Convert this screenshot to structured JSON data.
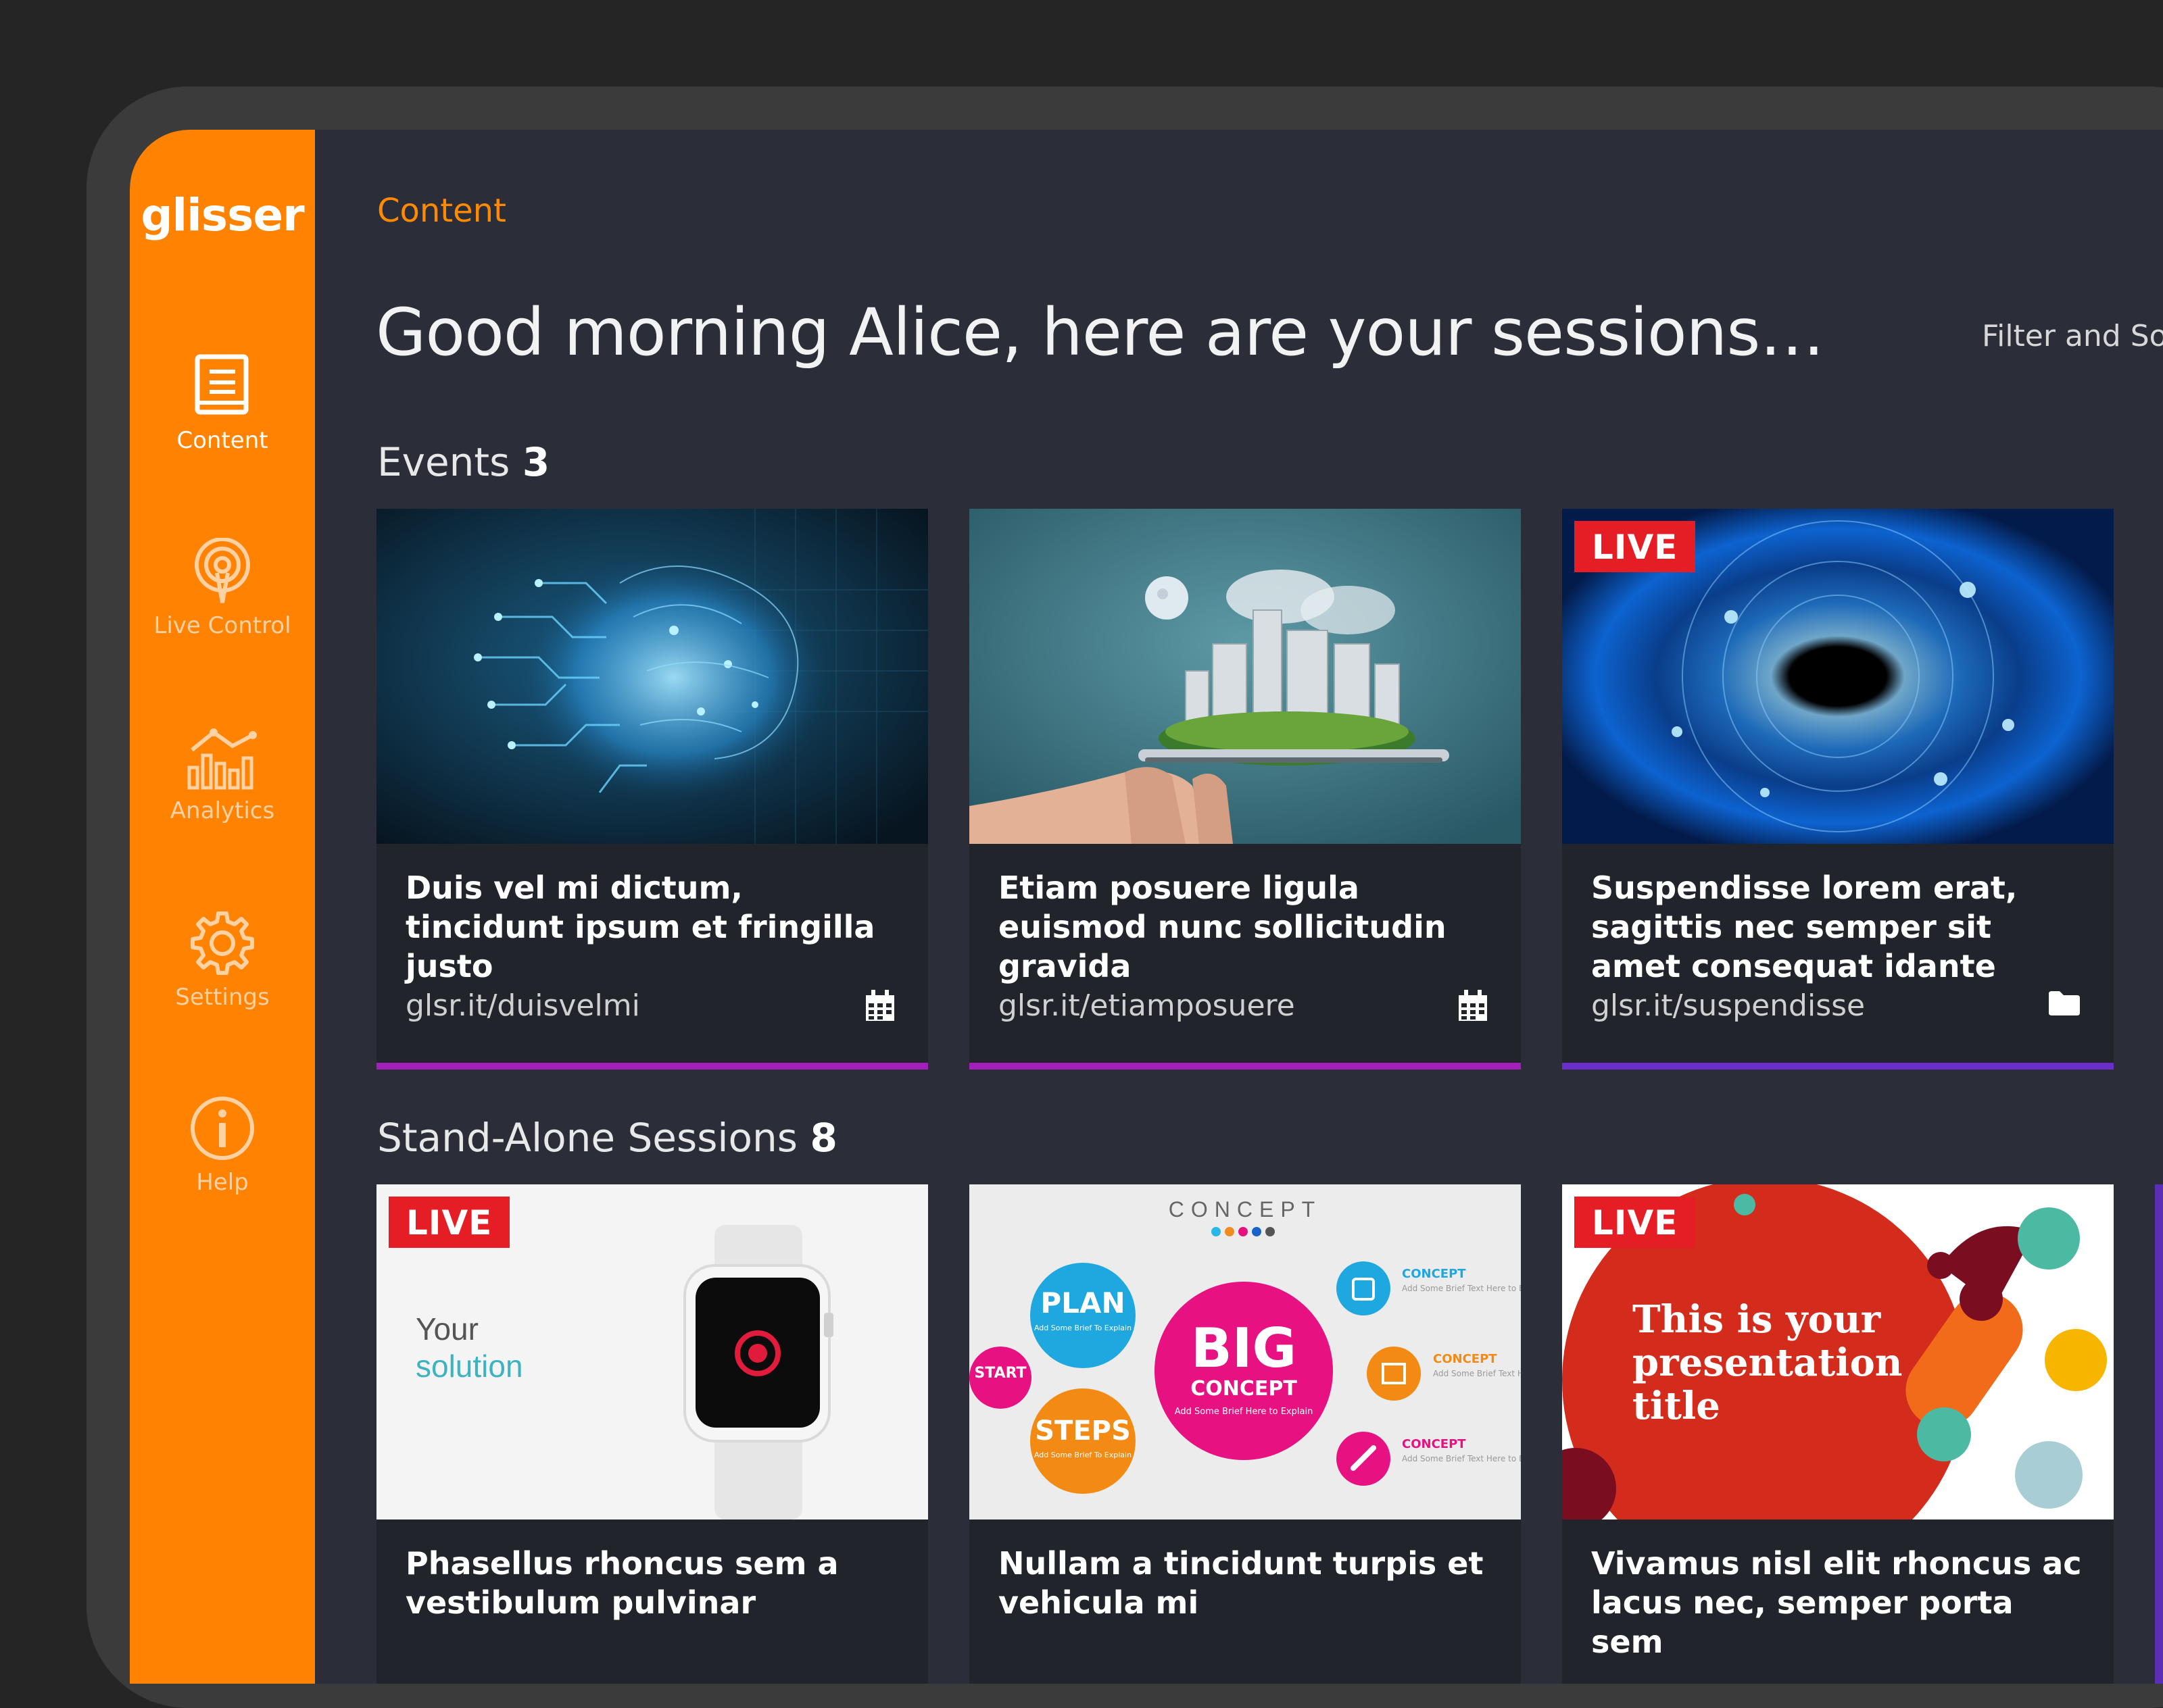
{
  "app": {
    "logo": "glisser",
    "accent_color": "#ff8200"
  },
  "sidebar": {
    "items": [
      {
        "label": "Content",
        "icon": "book-icon",
        "active": true
      },
      {
        "label": "Live Control",
        "icon": "broadcast-icon",
        "active": false
      },
      {
        "label": "Analytics",
        "icon": "chart-icon",
        "active": false
      },
      {
        "label": "Settings",
        "icon": "gear-icon",
        "active": false
      },
      {
        "label": "Help",
        "icon": "info-icon",
        "active": false
      }
    ]
  },
  "header": {
    "breadcrumb": "Content",
    "greeting": "Good morning Alice, here are your sessions…",
    "filter_label": "Filter and Sor"
  },
  "events": {
    "label": "Events",
    "count": "3",
    "cards": [
      {
        "title": "Duis vel mi dictum, tincidunt ipsum et fringilla justo",
        "link": "glsr.it/duisvelmi",
        "icon": "calendar-icon",
        "live": false,
        "bar_color": "#a21fbb"
      },
      {
        "title": "Etiam posuere ligula euismod nunc sollicitudin gravida",
        "link": "glsr.it/etiamposuere",
        "icon": "calendar-icon",
        "live": false,
        "bar_color": "#a21fbb"
      },
      {
        "title": "Suspendisse lorem erat, sagittis nec semper sit amet consequat idante",
        "link": "glsr.it/suspendisse",
        "icon": "folder-icon",
        "live": true,
        "live_label": "LIVE",
        "bar_color": "#6a2fc8"
      }
    ]
  },
  "standalone": {
    "label": "Stand-Alone Sessions",
    "count": "8",
    "cards": [
      {
        "title": "Phasellus rhoncus sem a vestibulum pulvinar",
        "live": true,
        "live_label": "LIVE",
        "thumb_text_1": "Your",
        "thumb_text_2": "solution"
      },
      {
        "title": "Nullam a tincidunt turpis et vehicula mi",
        "live": false,
        "thumb_heading": "CONCEPT",
        "thumb_big": "BIG",
        "thumb_big_sub": "CONCEPT",
        "thumb_big_note": "Add Some Brief Here to Explain",
        "thumb_plan": "PLAN",
        "thumb_start": "START",
        "thumb_steps": "STEPS",
        "thumb_concept_label": "CONCEPT",
        "thumb_concept_note": "Add Some Brief Text Here to Explain",
        "thumb_circle_note": "Add Some Brief To Explain"
      },
      {
        "title": "Vivamus nisl elit rhoncus ac lacus nec, semper porta sem",
        "live": true,
        "live_label": "LIVE",
        "thumb_text": "This is your presentation title"
      }
    ]
  }
}
